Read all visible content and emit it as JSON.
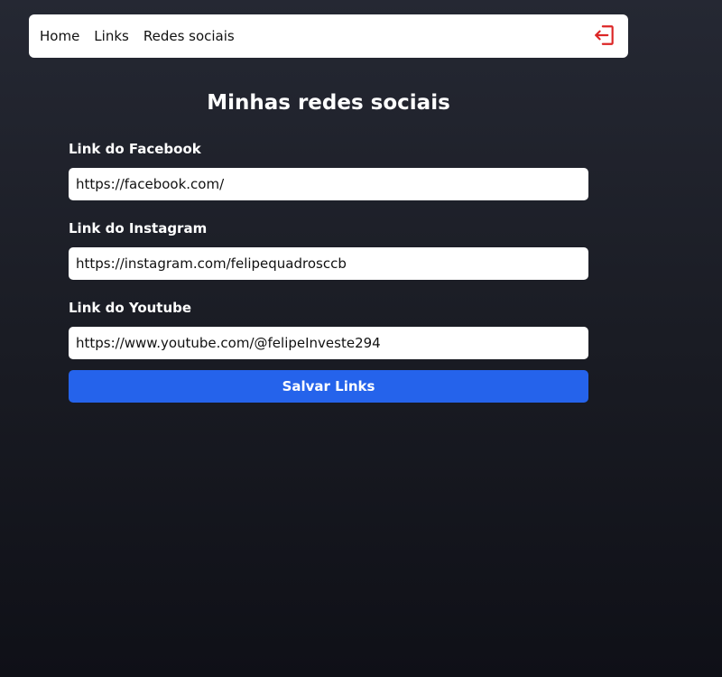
{
  "navbar": {
    "links": [
      {
        "label": "Home"
      },
      {
        "label": "Links"
      },
      {
        "label": "Redes sociais"
      }
    ],
    "logout_icon": "logout-icon",
    "logout_color": "#dc2626"
  },
  "main": {
    "title": "Minhas redes sociais",
    "fields": [
      {
        "label": "Link do Facebook",
        "value": "https://facebook.com/"
      },
      {
        "label": "Link do Instagram",
        "value": "https://instagram.com/felipequadrosccb"
      },
      {
        "label": "Link do Youtube",
        "value": "https://www.youtube.com/@felipeInveste294"
      }
    ],
    "save_label": "Salvar Links"
  },
  "colors": {
    "accent": "#2563eb",
    "background": "#1a1c24"
  }
}
